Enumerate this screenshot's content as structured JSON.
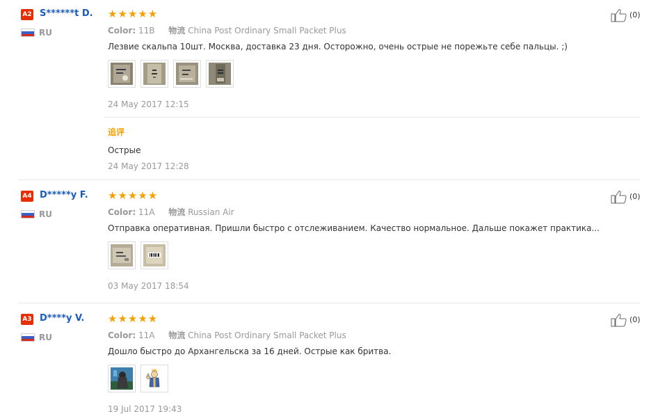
{
  "colors": {
    "username": "#1a5bbd",
    "badge": "#e62e04",
    "stars": "#f5a000",
    "followup": "#f5a000",
    "muted": "#999999"
  },
  "labels": {
    "color": "Color:",
    "shipping": "物流",
    "followup": "追评"
  },
  "reviews": [
    {
      "level": "A2",
      "user": "S******t D.",
      "country": "RU",
      "rating": 5,
      "stars": "★★★★★",
      "color": "11B",
      "shipping": "China Post Ordinary Small Packet Plus",
      "text": "Лезвие скальпа 10шт. Москва, доставка 23 дня. Осторожно, очень острые не порежьте себе пальцы. ;)",
      "date": "24 May 2017 12:15",
      "likes": "(0)",
      "photos": 4,
      "followup": {
        "text": "Острые",
        "date": "24 May 2017 12:28"
      }
    },
    {
      "level": "A4",
      "user": "D*****y F.",
      "country": "RU",
      "rating": 5,
      "stars": "★★★★★",
      "color": "11A",
      "shipping": "Russian Air",
      "text": "Отправка оперативная. Пришли быстро с отслеживанием. Качество нормальное. Дальше покажет практика...",
      "date": "03 May 2017 18:54",
      "likes": "(0)",
      "photos": 2
    },
    {
      "level": "A3",
      "user": "D****y V.",
      "country": "RU",
      "rating": 5,
      "stars": "★★★★★",
      "color": "11A",
      "shipping": "China Post Ordinary Small Packet Plus",
      "text": "Дошло быстро до Архангельска за 16 дней. Острые как бритва.",
      "date": "19 Jul 2017 19:43",
      "likes": "(0)",
      "photos": 2
    }
  ]
}
